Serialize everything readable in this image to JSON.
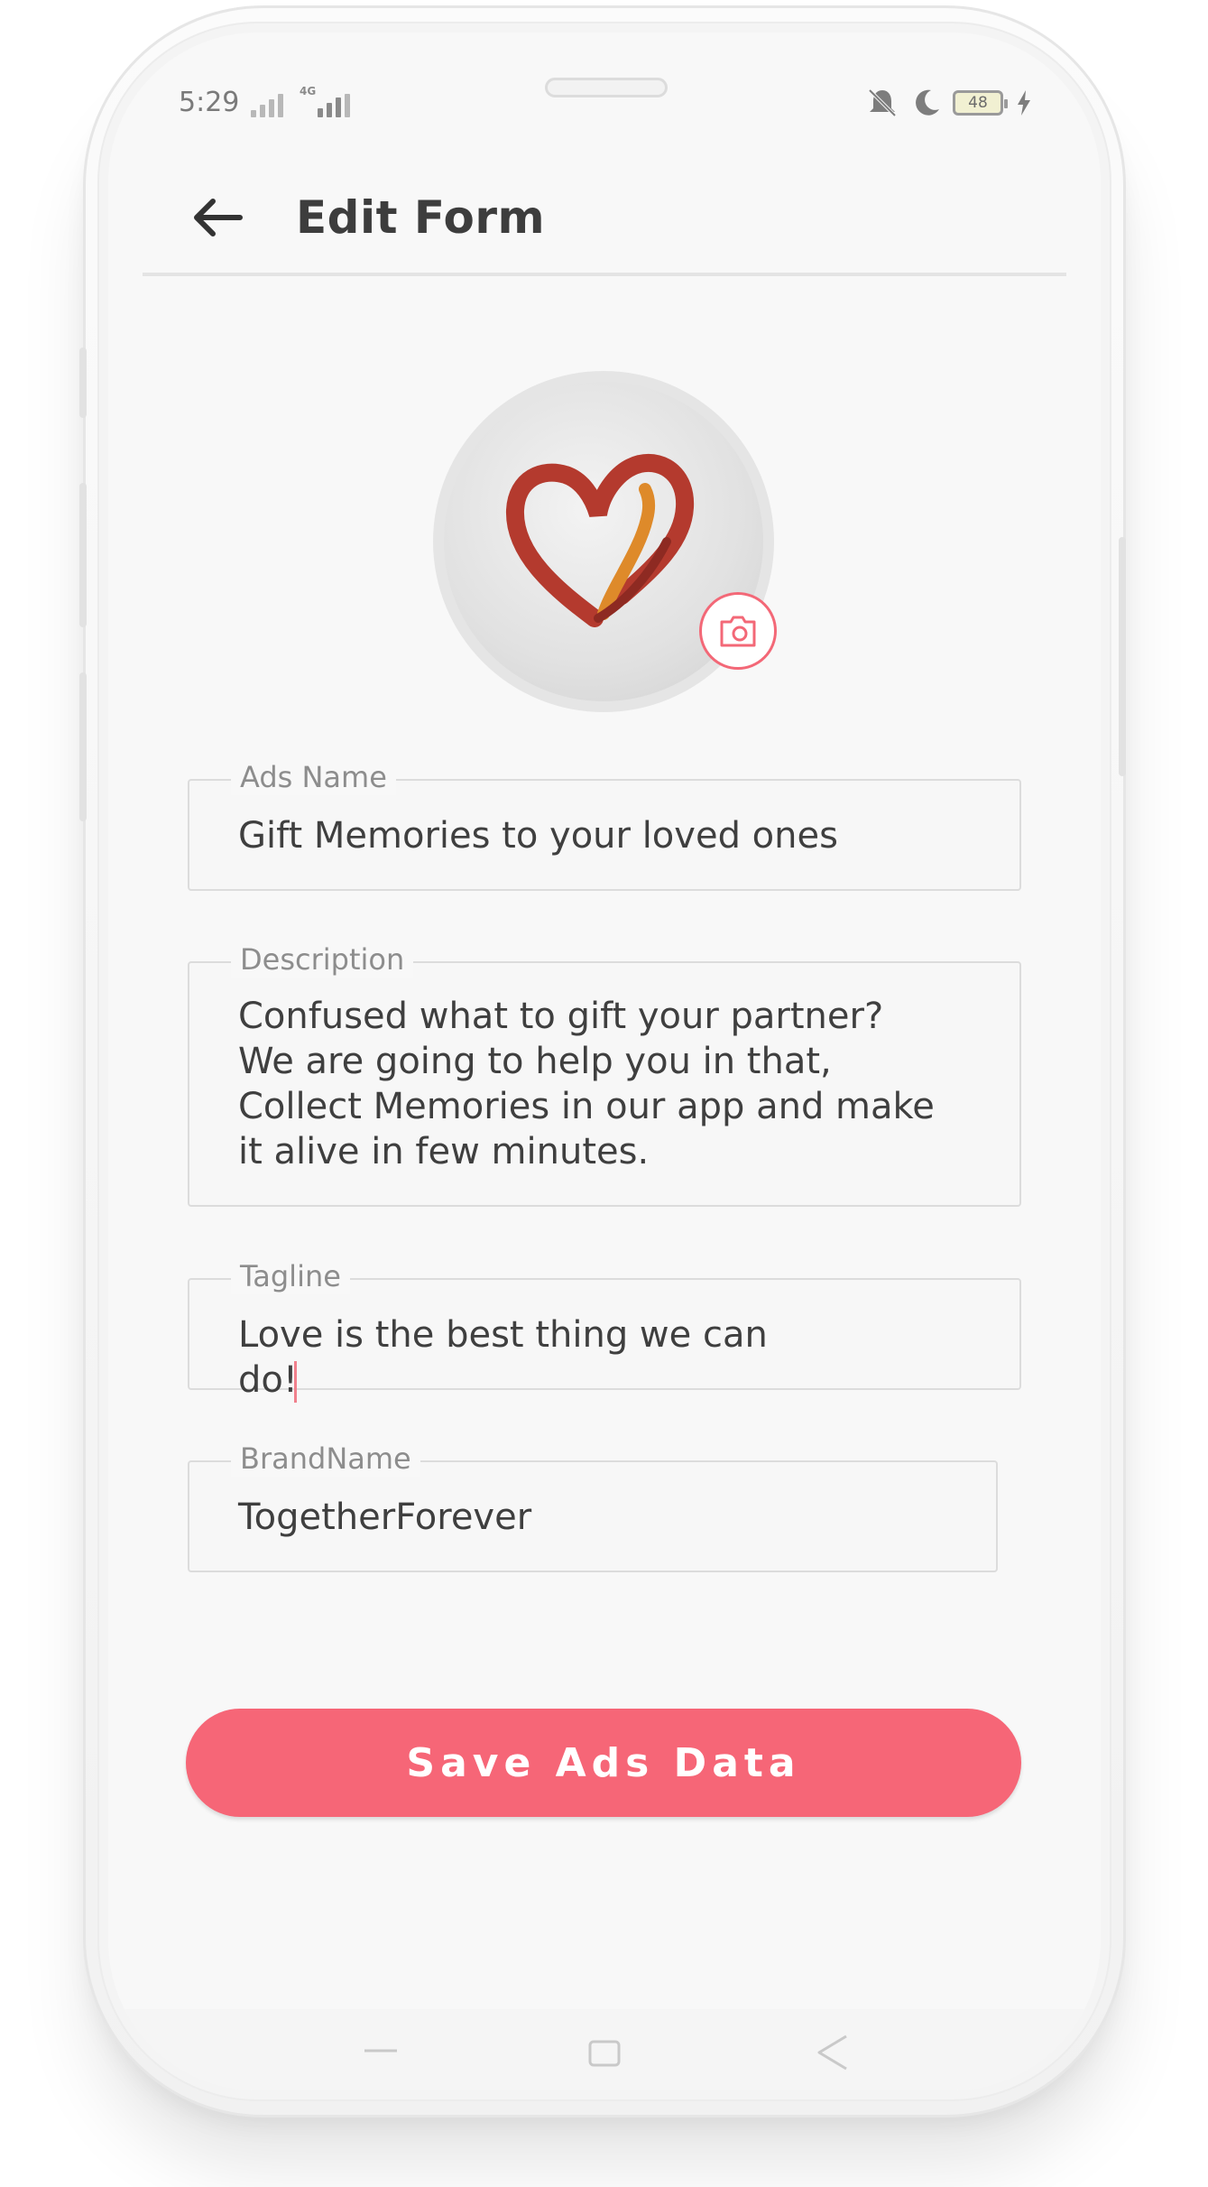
{
  "status_bar": {
    "time": "5:29",
    "network": "4G",
    "battery": "48",
    "icons": [
      "signal-icon",
      "mute-icon",
      "moon-icon",
      "battery-icon",
      "charging-icon"
    ]
  },
  "header": {
    "title": "Edit Form",
    "back_icon": "arrow-left-icon"
  },
  "avatar": {
    "image": "heart-logo",
    "camera_icon": "camera-icon"
  },
  "form": {
    "ads_name": {
      "label": "Ads Name",
      "value": "Gift Memories to your loved ones"
    },
    "description": {
      "label": "Description",
      "lines": [
        "Confused what to gift your partner?",
        "We are going to help you in that,",
        "Collect Memories in our app and make",
        "it alive in few minutes."
      ]
    },
    "tagline": {
      "label": "Tagline",
      "value": "Love is the best thing we can do!"
    },
    "brand_name": {
      "label": "BrandName",
      "value": "TogetherForever"
    }
  },
  "actions": {
    "save_label": "Save Ads Data"
  },
  "colors": {
    "accent": "#f66677",
    "background": "#f8f8f8",
    "text": "#3f3f3f",
    "label": "#8d8d8d"
  }
}
